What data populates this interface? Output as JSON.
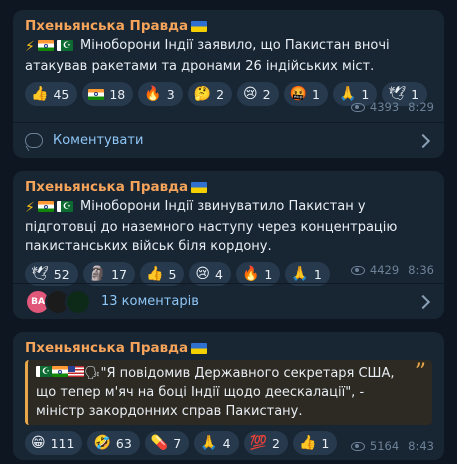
{
  "posts": [
    {
      "channel": "Пхеньянська Правда",
      "text": "Міноборони Індії заявило, що Пакистан вночі атакував ракетами та дронами 26 індійських міст.",
      "reactions": [
        {
          "emoji": "👍",
          "count": "45"
        },
        {
          "emoji": "🇮🇳",
          "count": "18"
        },
        {
          "emoji": "🔥",
          "count": "3"
        },
        {
          "emoji": "🤔",
          "count": "2"
        },
        {
          "emoji": "😢",
          "count": "2"
        },
        {
          "emoji": "🤬",
          "count": "1"
        },
        {
          "emoji": "🙏",
          "count": "1"
        },
        {
          "emoji": "🕊",
          "count": "1"
        }
      ],
      "views": "4393",
      "time": "8:29",
      "footer_label": "Коментувати"
    },
    {
      "channel": "Пхеньянська Правда",
      "text": "Міноборони Індії звинуватило Пакистан у підготовці до наземного наступу через концентрацію пакистанських військ біля кордону.",
      "reactions": [
        {
          "emoji": "🕊",
          "count": "52"
        },
        {
          "emoji": "🗿",
          "count": "17"
        },
        {
          "emoji": "👍",
          "count": "5"
        },
        {
          "emoji": "😢",
          "count": "4"
        },
        {
          "emoji": "🔥",
          "count": "1"
        },
        {
          "emoji": "🙏",
          "count": "1"
        }
      ],
      "views": "4429",
      "time": "8:36",
      "avatar_initials": "BA",
      "footer_label": "13 коментарів"
    },
    {
      "channel": "Пхеньянська Правда",
      "quote": "\"Я повідомив Державного секретаря США, що тепер м'яч на боці Індії щодо деескалації\", - міністр закордонних справ Пакистану.",
      "reactions": [
        {
          "emoji": "😁",
          "count": "111"
        },
        {
          "emoji": "🤣",
          "count": "63"
        },
        {
          "emoji": "💊",
          "count": "7"
        },
        {
          "emoji": "🙏",
          "count": "4"
        },
        {
          "emoji": "💯",
          "count": "2"
        },
        {
          "emoji": "👍",
          "count": "1"
        }
      ],
      "views": "5164",
      "time": "8:43"
    }
  ],
  "colors": {
    "background": "#0e1621",
    "bubble": "#182533",
    "channel_name": "#f5a45a",
    "link": "#8ec6f5",
    "reaction_bg": "#27394c",
    "quote_accent": "#e8a84a"
  }
}
